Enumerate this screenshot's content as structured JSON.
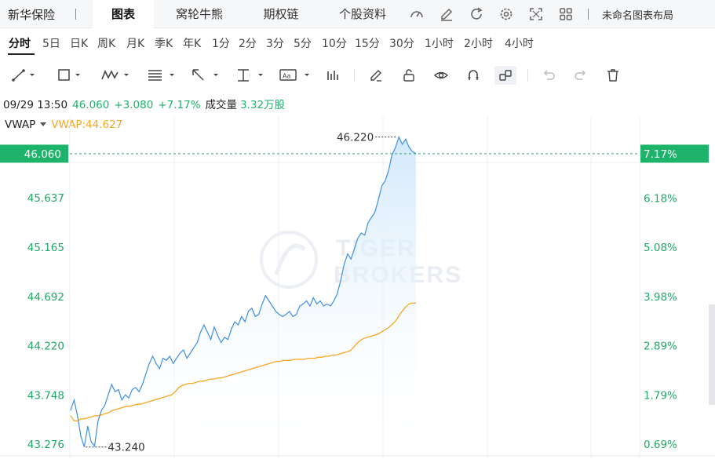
{
  "header": {
    "stock_name": "新华保险",
    "tabs": [
      {
        "label": "图表",
        "active": true
      },
      {
        "label": "窝轮牛熊",
        "active": false
      },
      {
        "label": "期权链",
        "active": false
      },
      {
        "label": "个股资料",
        "active": false
      }
    ],
    "icons": [
      "gauge-icon",
      "edit-icon",
      "refresh-icon",
      "settings-icon",
      "fullscreen-icon",
      "grid-layout-icon"
    ],
    "layout_name": "未命名图表布局"
  },
  "periods": [
    "分时",
    "5日",
    "日K",
    "周K",
    "月K",
    "季K",
    "年K",
    "1分",
    "2分",
    "3分",
    "5分",
    "10分",
    "15分",
    "30分",
    "1小时",
    "2小时",
    "4小时"
  ],
  "active_period": "分时",
  "info": {
    "datetime": "09/29 13:50",
    "price": "46.060",
    "change": "+3.080",
    "change_pct": "+7.17%",
    "volume_label": "成交量",
    "volume_value": "3.32万股"
  },
  "indicator": {
    "name": "VWAP",
    "value_text": "VWAP:44.627"
  },
  "colors": {
    "up": "#1db36b",
    "price_line": "#3d8fe0",
    "vwap_line": "#f5a623"
  },
  "chart_data": {
    "type": "line",
    "y_left_ticks": [
      "45.637",
      "45.165",
      "44.692",
      "44.220",
      "43.748",
      "43.276"
    ],
    "y_right_ticks": [
      "7.17%",
      "6.18%",
      "5.08%",
      "3.98%",
      "2.89%",
      "1.79%",
      "0.69%"
    ],
    "current_price_label": "46.060",
    "high_label": "46.220",
    "low_label": "43.240",
    "ylim": [
      43.15,
      46.42
    ],
    "prev_close": 42.98,
    "series": [
      {
        "key": "price",
        "values": [
          43.6,
          43.7,
          43.55,
          43.35,
          43.25,
          43.45,
          43.3,
          43.26,
          43.5,
          43.6,
          43.65,
          43.75,
          43.85,
          43.78,
          43.8,
          43.7,
          43.75,
          43.72,
          43.8,
          43.82,
          43.78,
          43.85,
          43.95,
          44.05,
          44.12,
          44.05,
          44.0,
          44.1,
          44.08,
          44.12,
          44.05,
          44.1,
          44.15,
          44.18,
          44.1,
          44.15,
          44.2,
          44.25,
          44.35,
          44.42,
          44.35,
          44.28,
          44.4,
          44.32,
          44.25,
          44.3,
          44.28,
          44.38,
          44.45,
          44.42,
          44.5,
          44.45,
          44.55,
          44.58,
          44.5,
          44.52,
          44.62,
          44.7,
          44.65,
          44.6,
          44.55,
          44.52,
          44.5,
          44.52,
          44.55,
          44.5,
          44.52,
          44.6,
          44.62,
          44.65,
          44.6,
          44.68,
          44.62,
          44.65,
          44.6,
          44.62,
          44.6,
          44.65,
          44.72,
          44.85,
          45.0,
          45.1,
          45.05,
          45.15,
          45.25,
          45.3,
          45.28,
          45.4,
          45.45,
          45.5,
          45.62,
          45.75,
          45.8,
          45.9,
          46.05,
          46.12,
          46.22,
          46.15,
          46.2,
          46.12,
          46.08,
          46.06
        ]
      },
      {
        "key": "vwap",
        "values": [
          43.55,
          43.5,
          43.5,
          43.52,
          43.52,
          43.53,
          43.54,
          43.55,
          43.55,
          43.56,
          43.57,
          43.58,
          43.6,
          43.61,
          43.62,
          43.63,
          43.64,
          43.64,
          43.65,
          43.66,
          43.66,
          43.67,
          43.68,
          43.69,
          43.7,
          43.71,
          43.72,
          43.73,
          43.74,
          43.75,
          43.78,
          43.82,
          43.84,
          43.85,
          43.86,
          43.86,
          43.87,
          43.88,
          43.88,
          43.89,
          43.9,
          43.9,
          43.91,
          43.91,
          43.92,
          43.93,
          43.94,
          43.95,
          43.96,
          43.97,
          43.98,
          43.99,
          44.0,
          44.01,
          44.02,
          44.03,
          44.04,
          44.05,
          44.06,
          44.07,
          44.07,
          44.08,
          44.08,
          44.08,
          44.09,
          44.09,
          44.09,
          44.09,
          44.1,
          44.1,
          44.1,
          44.11,
          44.11,
          44.12,
          44.12,
          44.13,
          44.13,
          44.14,
          44.15,
          44.16,
          44.17,
          44.2,
          44.24,
          44.27,
          44.29,
          44.3,
          44.31,
          44.32,
          44.33,
          44.35,
          44.37,
          44.39,
          44.42,
          44.45,
          44.5,
          44.55,
          44.59,
          44.62,
          44.63,
          44.627
        ]
      }
    ]
  }
}
